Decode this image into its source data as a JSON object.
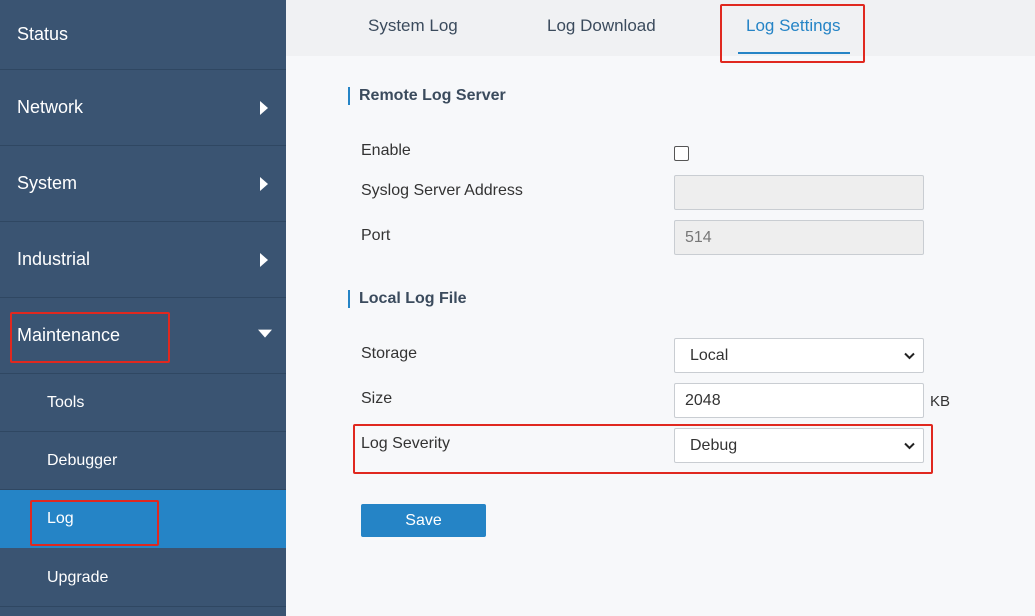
{
  "sidebar": {
    "status": "Status",
    "network": "Network",
    "system": "System",
    "industrial": "Industrial",
    "maintenance": "Maintenance",
    "tools": "Tools",
    "debugger": "Debugger",
    "log": "Log",
    "upgrade": "Upgrade"
  },
  "tabs": {
    "system_log": "System Log",
    "log_download": "Log Download",
    "log_settings": "Log Settings"
  },
  "remote": {
    "title": "Remote Log Server",
    "enable_label": "Enable",
    "enable_checked": false,
    "address_label": "Syslog Server Address",
    "address_value": "",
    "port_label": "Port",
    "port_value": "514"
  },
  "local": {
    "title": "Local Log File",
    "storage_label": "Storage",
    "storage_value": "Local",
    "size_label": "Size",
    "size_value": "2048",
    "size_unit": "KB",
    "severity_label": "Log Severity",
    "severity_value": "Debug"
  },
  "actions": {
    "save": "Save"
  },
  "colors": {
    "sidebar_bg": "#3a5472",
    "active_item": "#2584c6",
    "highlight": "#e0281f"
  }
}
